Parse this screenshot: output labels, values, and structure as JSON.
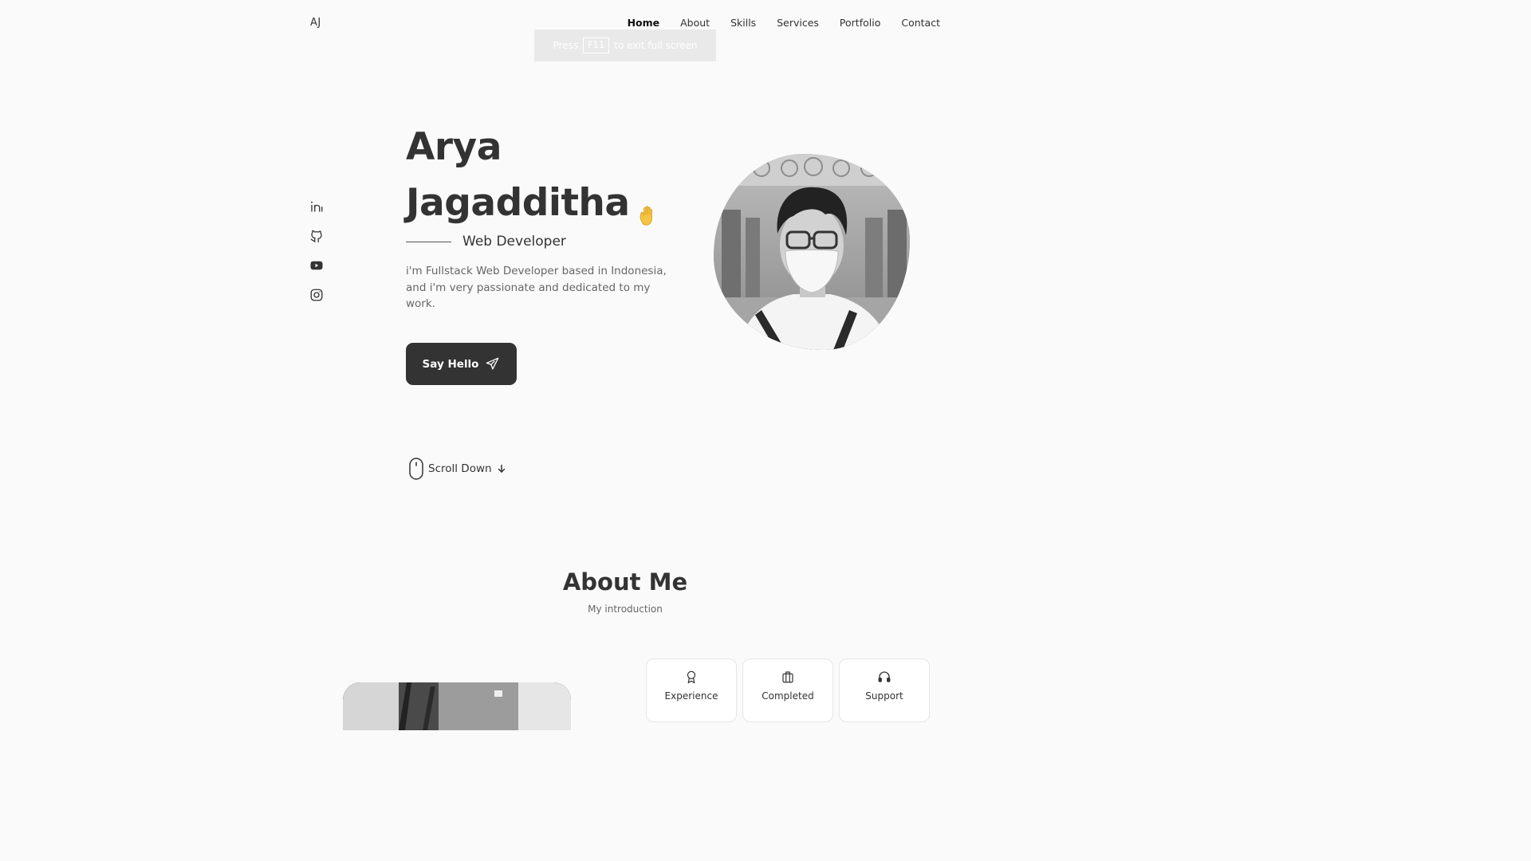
{
  "header": {
    "logo": "AJ",
    "nav": [
      {
        "label": "Home",
        "active": true
      },
      {
        "label": "About",
        "active": false
      },
      {
        "label": "Skills",
        "active": false
      },
      {
        "label": "Services",
        "active": false
      },
      {
        "label": "Portfolio",
        "active": false
      },
      {
        "label": "Contact",
        "active": false
      }
    ]
  },
  "fullscreen_toast": {
    "prefix": "Press",
    "key": "F11",
    "suffix": "to exit full screen"
  },
  "socials": [
    {
      "name": "linkedin",
      "icon": "linkedin-icon"
    },
    {
      "name": "github",
      "icon": "github-icon"
    },
    {
      "name": "youtube",
      "icon": "youtube-icon"
    },
    {
      "name": "instagram",
      "icon": "instagram-icon"
    }
  ],
  "hero": {
    "first_name": "Arya",
    "last_name": "Jagadditha",
    "wave_icon": "waving-hand-icon",
    "subtitle": "Web Developer",
    "description": "i'm Fullstack Web Developer based in Indonesia, and i'm very passionate and dedicated to my work.",
    "cta_label": "Say Hello",
    "cta_icon": "send-icon",
    "scroll_label": "Scroll Down"
  },
  "about": {
    "title": "About Me",
    "subtitle": "My introduction",
    "cards": [
      {
        "title": "Experience",
        "icon": "award-icon"
      },
      {
        "title": "Completed",
        "icon": "briefcase-icon"
      },
      {
        "title": "Support",
        "icon": "headphones-icon"
      }
    ]
  },
  "colors": {
    "background": "#fafafa",
    "text": "#333333",
    "button": "#333333",
    "muted": "#666666"
  }
}
